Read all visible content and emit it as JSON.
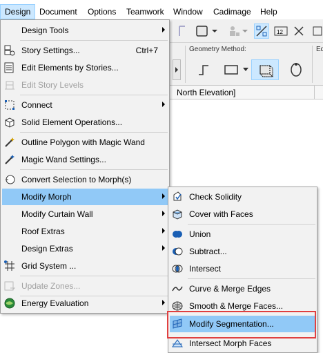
{
  "menubar": {
    "items": [
      "Design",
      "Document",
      "Options",
      "Teamwork",
      "Window",
      "Cadimage",
      "Help"
    ]
  },
  "toolbar": {
    "geometry_method_label": "Geometry Method:",
    "view_tab_label": "North Elevation]"
  },
  "design_menu": {
    "items": [
      {
        "label": "Design Tools",
        "icon": "none",
        "submenu": true
      },
      {
        "label": "Story Settings...",
        "shortcut": "Ctrl+7",
        "icon": "story-settings-icon"
      },
      {
        "label": "Edit Elements by Stories...",
        "icon": "edit-elements-icon"
      },
      {
        "label": "Edit Story Levels",
        "icon": "story-levels-icon",
        "disabled": true
      },
      {
        "label": "Connect",
        "icon": "connect-icon",
        "submenu": true
      },
      {
        "label": "Solid Element Operations...",
        "icon": "solid-ops-icon"
      },
      {
        "label": "Outline Polygon with Magic Wand",
        "icon": "magic-wand-icon"
      },
      {
        "label": "Magic Wand Settings...",
        "icon": "magic-wand-settings-icon"
      },
      {
        "label": "Convert Selection to Morph(s)",
        "icon": "convert-morph-icon"
      },
      {
        "label": "Modify Morph",
        "icon": "none",
        "submenu": true,
        "highlighted": true
      },
      {
        "label": "Modify Curtain Wall",
        "icon": "none",
        "submenu": true
      },
      {
        "label": "Roof Extras",
        "icon": "none",
        "submenu": true
      },
      {
        "label": "Design Extras",
        "icon": "none",
        "submenu": true
      },
      {
        "label": "Grid System ...",
        "icon": "grid-system-icon"
      },
      {
        "label": "Update Zones...",
        "icon": "update-zones-icon",
        "disabled": true
      },
      {
        "label": "Energy Evaluation",
        "icon": "energy-evaluation-icon",
        "submenu": true
      }
    ]
  },
  "modify_morph_submenu": {
    "items": [
      {
        "label": "Check Solidity",
        "icon": "check-solidity-icon"
      },
      {
        "label": "Cover with Faces",
        "icon": "cover-faces-icon"
      },
      {
        "label": "Union",
        "icon": "union-icon"
      },
      {
        "label": "Subtract...",
        "icon": "subtract-icon"
      },
      {
        "label": "Intersect",
        "icon": "intersect-icon"
      },
      {
        "label": "Curve & Merge Edges",
        "icon": "curve-edges-icon"
      },
      {
        "label": "Smooth & Merge Faces...",
        "icon": "smooth-faces-icon"
      },
      {
        "label": "Modify Segmentation...",
        "icon": "modify-segmentation-icon",
        "highlighted": true
      },
      {
        "label": "Intersect Morph Faces",
        "icon": "intersect-morph-faces-icon"
      }
    ]
  },
  "colors": {
    "menu_bg": "#f2f2f2",
    "highlight": "#91c9f7",
    "focus_outline": "#e04040"
  }
}
